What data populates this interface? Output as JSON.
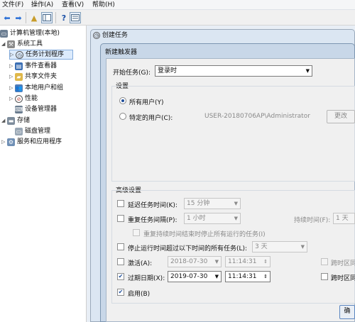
{
  "menubar": {
    "items": [
      "文件(F)",
      "操作(A)",
      "查看(V)",
      "帮助(H)"
    ]
  },
  "toolbar": {
    "icons": [
      "back-arrow-icon",
      "forward-arrow-icon",
      "folder-up-icon",
      "show-hide-tree-icon",
      "help-icon",
      "properties-icon"
    ]
  },
  "tree": {
    "root": "计算机管理(本地)",
    "system_tools": "系统工具",
    "task_scheduler": "任务计划程序",
    "event_viewer": "事件查看器",
    "shared_folders": "共享文件夹",
    "local_users": "本地用户和组",
    "performance": "性能",
    "device_manager": "设备管理器",
    "storage": "存储",
    "disk_management": "磁盘管理",
    "services": "服务和应用程序"
  },
  "background_window": {
    "title": "创建任务"
  },
  "dialog": {
    "title": "新建触发器",
    "begin_task_label": "开始任务(G):",
    "begin_task_value": "登录时",
    "settings_header": "设置",
    "radio_all_users": "所有用户(Y)",
    "radio_specific_user": "特定的用户(C):",
    "specific_user_value": "USER-20180706AP\\Administrator",
    "change_user_button": "更改",
    "advanced_header": "高级设置",
    "delay_label": "延迟任务时间(K):",
    "delay_value": "15 分钟",
    "repeat_label": "重复任务间隔(P):",
    "repeat_value": "1 小时",
    "duration_label": "持续时间(F):",
    "duration_value": "1 天",
    "stop_repeat_label": "重复持续时间结束时停止所有运行的任务(I)",
    "stop_longer_label": "停止运行时间超过以下时间的所有任务(L):",
    "stop_longer_value": "3 天",
    "activate_label": "激活(A):",
    "activate_date": "2018-07-30",
    "activate_time": "11:14:31",
    "sync_tz_label_1": "跨时区同",
    "expire_label": "过期日期(X):",
    "expire_date": "2019-07-30",
    "expire_time": "11:14:31",
    "sync_tz_label_2": "跨时区同",
    "enabled_label": "启用(B)",
    "ok_button": "确"
  },
  "colors": {
    "selection": "#dcebfc",
    "dialog_frame": "#c8d7e8",
    "content_bg": "#f0f0f0"
  }
}
